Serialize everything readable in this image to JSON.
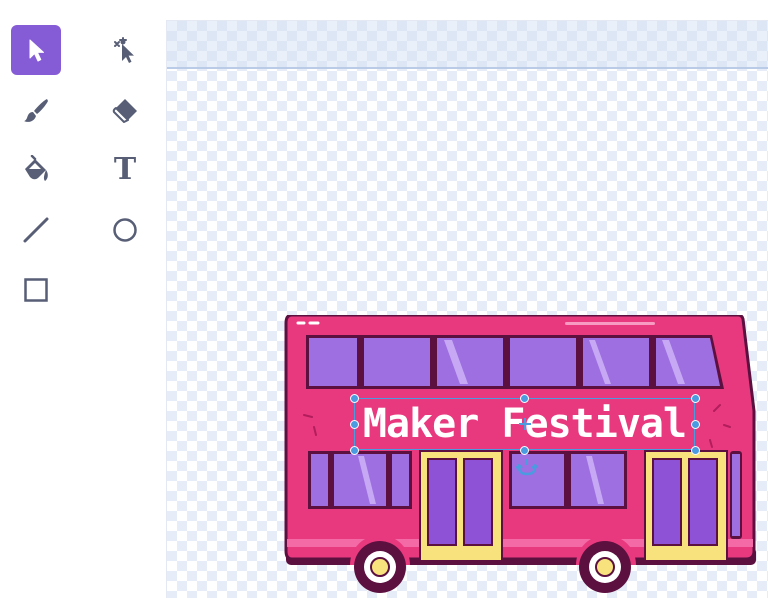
{
  "toolbar": {
    "tools": [
      {
        "id": "select",
        "label": "Select",
        "icon": "arrow-pointer-icon",
        "selected": true
      },
      {
        "id": "reshape",
        "label": "Reshape",
        "icon": "reshape-pointer-icon",
        "selected": false
      },
      {
        "id": "brush",
        "label": "Brush",
        "icon": "brush-icon",
        "selected": false
      },
      {
        "id": "eraser",
        "label": "Eraser",
        "icon": "eraser-icon",
        "selected": false
      },
      {
        "id": "fill",
        "label": "Fill",
        "icon": "paint-bucket-icon",
        "selected": false
      },
      {
        "id": "text",
        "label": "Text",
        "glyph": "T",
        "icon": "text-icon",
        "selected": false
      },
      {
        "id": "line",
        "label": "Line",
        "icon": "line-icon",
        "selected": false
      },
      {
        "id": "circle",
        "label": "Circle",
        "icon": "circle-icon",
        "selected": false
      },
      {
        "id": "rectangle",
        "label": "Rectangle",
        "icon": "rectangle-icon",
        "selected": false
      }
    ]
  },
  "canvas": {
    "text_object": "Maker Festival"
  },
  "colors": {
    "accent": "#855cd6",
    "icon": "#575e75",
    "selection": "#4a9be0",
    "bus_body": "#e9397e",
    "bus_outline": "#5c1040",
    "window": "#9d6fe0",
    "door": "#f8e27d"
  }
}
